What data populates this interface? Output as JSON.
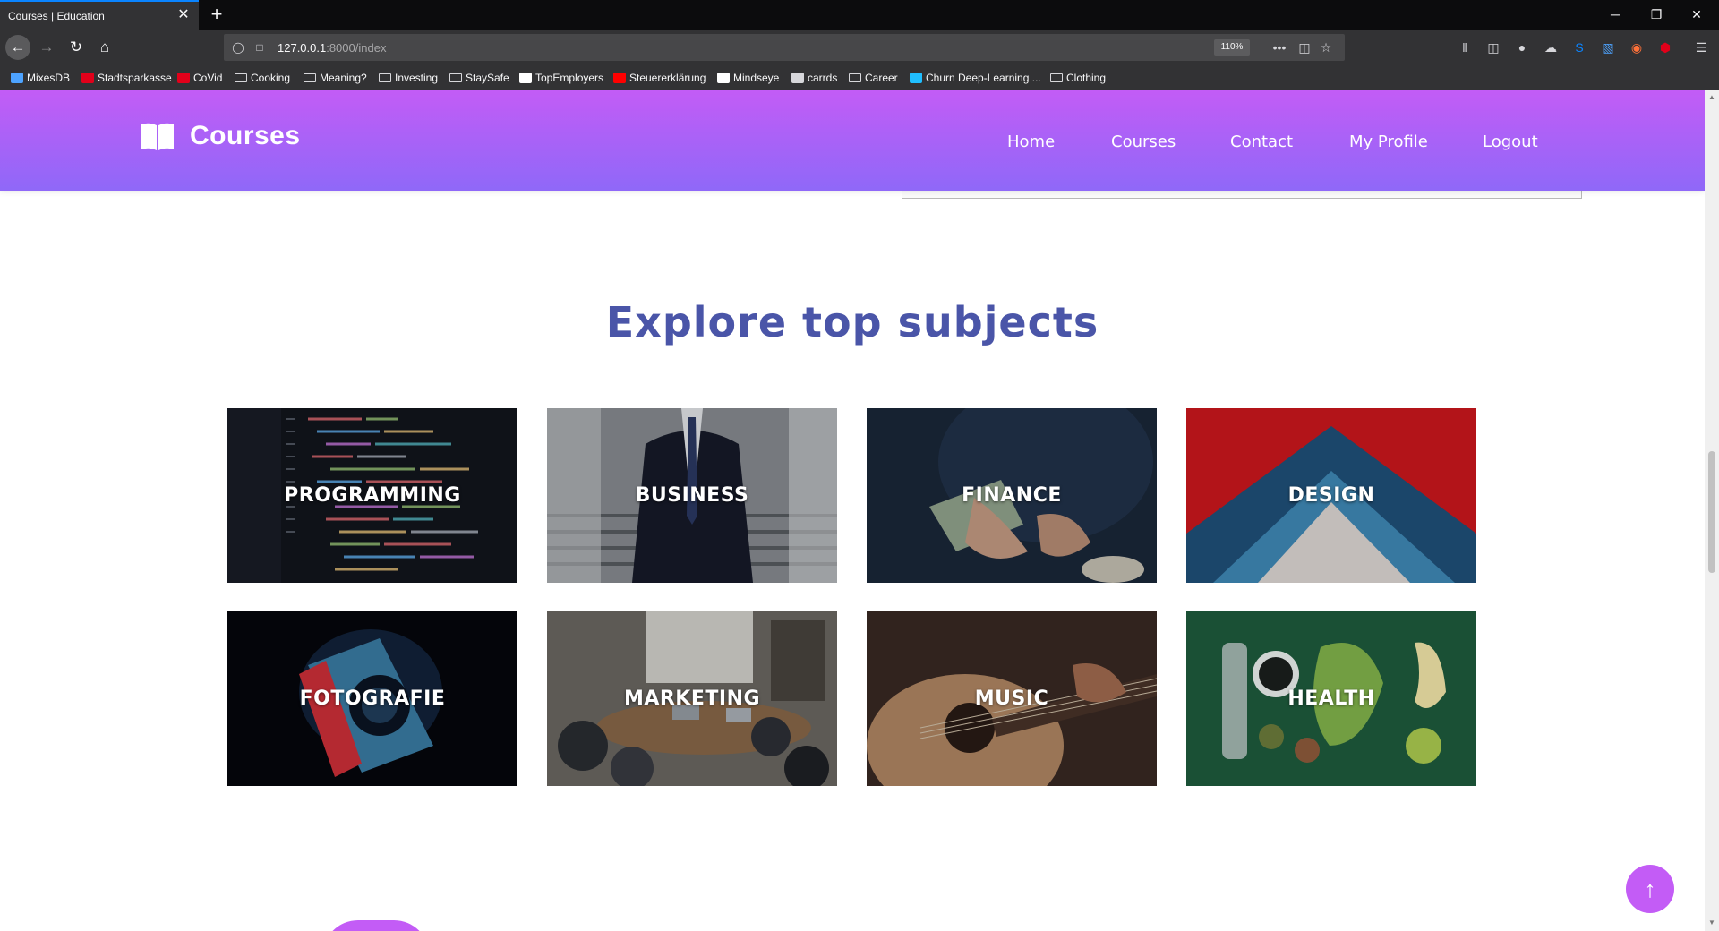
{
  "browser": {
    "tab_title": "Courses | Education",
    "tab_close": "✕",
    "new_tab": "+",
    "url_host": "127.0.0.1",
    "url_rest": ":8000/index",
    "zoom": "110%",
    "window_controls": [
      "─",
      "❐",
      "✕"
    ],
    "nav_icons": {
      "back": "←",
      "forward": "→",
      "reload": "↻",
      "home": "⌂"
    },
    "url_actions": [
      "•••",
      "◫",
      "☆"
    ],
    "bookmarks": [
      {
        "label": "MixesDB",
        "icon": "mixesdb-icon",
        "color": "#4da3ff"
      },
      {
        "label": "Stadtsparkasse",
        "icon": "sparkasse-icon",
        "color": "#e2001a"
      },
      {
        "label": "CoVid",
        "icon": "covid-icon",
        "color": "#e2001a"
      },
      {
        "label": "Cooking",
        "icon": "folder-icon",
        "color": ""
      },
      {
        "label": "Meaning?",
        "icon": "folder-icon",
        "color": ""
      },
      {
        "label": "Investing",
        "icon": "folder-icon",
        "color": ""
      },
      {
        "label": "StaySafe",
        "icon": "folder-icon",
        "color": ""
      },
      {
        "label": "TopEmployers",
        "icon": "m-icon",
        "color": "#ffffff"
      },
      {
        "label": "Steuererklärung",
        "icon": "youtube-icon",
        "color": "#ff0000"
      },
      {
        "label": "Mindseye",
        "icon": "mindseye-icon",
        "color": "#ffffff"
      },
      {
        "label": "carrds",
        "icon": "globe-icon",
        "color": "#d7d7db"
      },
      {
        "label": "Career",
        "icon": "folder-icon",
        "color": ""
      },
      {
        "label": "Churn Deep-Learning ...",
        "icon": "k-icon",
        "color": "#20beff"
      },
      {
        "label": "Clothing",
        "icon": "folder-icon",
        "color": ""
      }
    ]
  },
  "header": {
    "logo_text": "Courses",
    "menu": [
      "Home",
      "Courses",
      "Contact",
      "My Profile",
      "Logout"
    ]
  },
  "section": {
    "title": "Explore top subjects",
    "subjects": [
      {
        "label": "PROGRAMMING",
        "image": "code-screen-image"
      },
      {
        "label": "BUSINESS",
        "image": "businessman-image"
      },
      {
        "label": "FINANCE",
        "image": "money-counting-image"
      },
      {
        "label": "DESIGN",
        "image": "geometric-design-image"
      },
      {
        "label": "FOTOGRAFIE",
        "image": "camera-image"
      },
      {
        "label": "MARKETING",
        "image": "meeting-room-image"
      },
      {
        "label": "MUSIC",
        "image": "guitar-image"
      },
      {
        "label": "HEALTH",
        "image": "healthy-food-image"
      }
    ]
  },
  "scroll_top": {
    "icon": "↑"
  },
  "colors": {
    "brand_top": "#c35cf6",
    "brand_bottom": "#8f68f8",
    "title": "#4a55a8"
  }
}
